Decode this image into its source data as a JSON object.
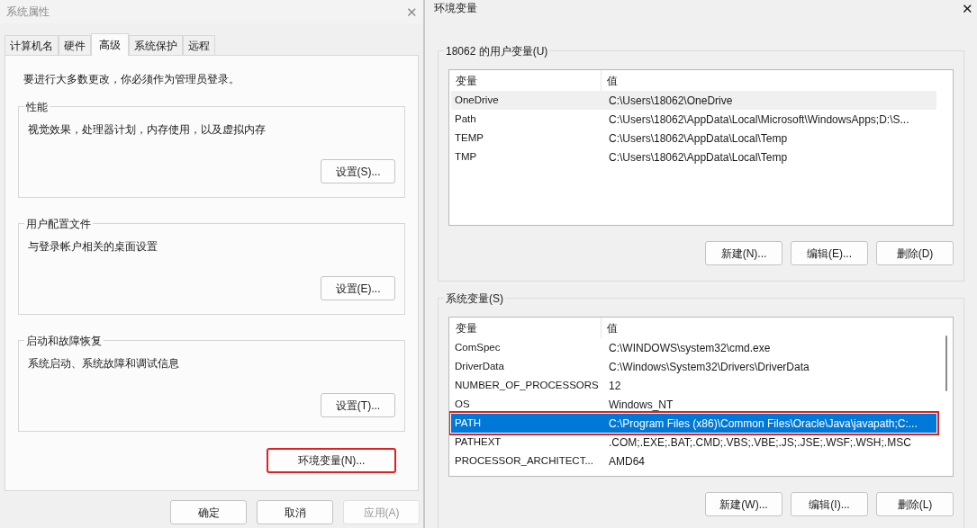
{
  "system_properties": {
    "title": "系统属性",
    "close": "✕",
    "tabs": [
      {
        "label": "计算机名",
        "selected": false
      },
      {
        "label": "硬件",
        "selected": false
      },
      {
        "label": "高级",
        "selected": true
      },
      {
        "label": "系统保护",
        "selected": false
      },
      {
        "label": "远程",
        "selected": false
      }
    ],
    "notice": "要进行大多数更改，你必须作为管理员登录。",
    "groups": [
      {
        "title": "性能",
        "description": "视觉效果，处理器计划，内存使用，以及虚拟内存",
        "button": "设置(S)..."
      },
      {
        "title": "用户配置文件",
        "description": "与登录帐户相关的桌面设置",
        "button": "设置(E)..."
      },
      {
        "title": "启动和故障恢复",
        "description": "系统启动、系统故障和调试信息",
        "button": "设置(T)..."
      }
    ],
    "env_button": {
      "label": "环境变量(N)...",
      "highlighted": true
    },
    "footer_buttons": [
      {
        "label": "确定",
        "disabled": false
      },
      {
        "label": "取消",
        "disabled": false
      },
      {
        "label": "应用(A)",
        "disabled": true
      }
    ]
  },
  "environment_variables": {
    "title": "环境变量",
    "close": "✕",
    "sections": [
      {
        "title": "18062 的用户变量(U)",
        "focused": false,
        "scrollbar": false,
        "columns": [
          "变量",
          "值"
        ],
        "rows": [
          {
            "name": "OneDrive",
            "value": "C:\\Users\\18062\\OneDrive",
            "selected": true,
            "highlighted": false
          },
          {
            "name": "Path",
            "value": "C:\\Users\\18062\\AppData\\Local\\Microsoft\\WindowsApps;D:\\S...",
            "selected": false,
            "highlighted": false
          },
          {
            "name": "TEMP",
            "value": "C:\\Users\\18062\\AppData\\Local\\Temp",
            "selected": false,
            "highlighted": false
          },
          {
            "name": "TMP",
            "value": "C:\\Users\\18062\\AppData\\Local\\Temp",
            "selected": false,
            "highlighted": false
          }
        ],
        "buttons": [
          "新建(N)...",
          "编辑(E)...",
          "删除(D)"
        ]
      },
      {
        "title": "系统变量(S)",
        "focused": true,
        "scrollbar": true,
        "columns": [
          "变量",
          "值"
        ],
        "rows": [
          {
            "name": "ComSpec",
            "value": "C:\\WINDOWS\\system32\\cmd.exe",
            "selected": false,
            "highlighted": false
          },
          {
            "name": "DriverData",
            "value": "C:\\Windows\\System32\\Drivers\\DriverData",
            "selected": false,
            "highlighted": false
          },
          {
            "name": "NUMBER_OF_PROCESSORS",
            "value": "12",
            "selected": false,
            "highlighted": false
          },
          {
            "name": "OS",
            "value": "Windows_NT",
            "selected": false,
            "highlighted": false
          },
          {
            "name": "PATH",
            "value": "C:\\Program Files (x86)\\Common Files\\Oracle\\Java\\javapath;C:...",
            "selected": true,
            "highlighted": true
          },
          {
            "name": "PATHEXT",
            "value": ".COM;.EXE;.BAT;.CMD;.VBS;.VBE;.JS;.JSE;.WSF;.WSH;.MSC",
            "selected": false,
            "highlighted": false
          },
          {
            "name": "PROCESSOR_ARCHITECT...",
            "value": "AMD64",
            "selected": false,
            "highlighted": false
          }
        ],
        "buttons": [
          "新建(W)...",
          "编辑(I)...",
          "删除(L)"
        ]
      }
    ]
  }
}
